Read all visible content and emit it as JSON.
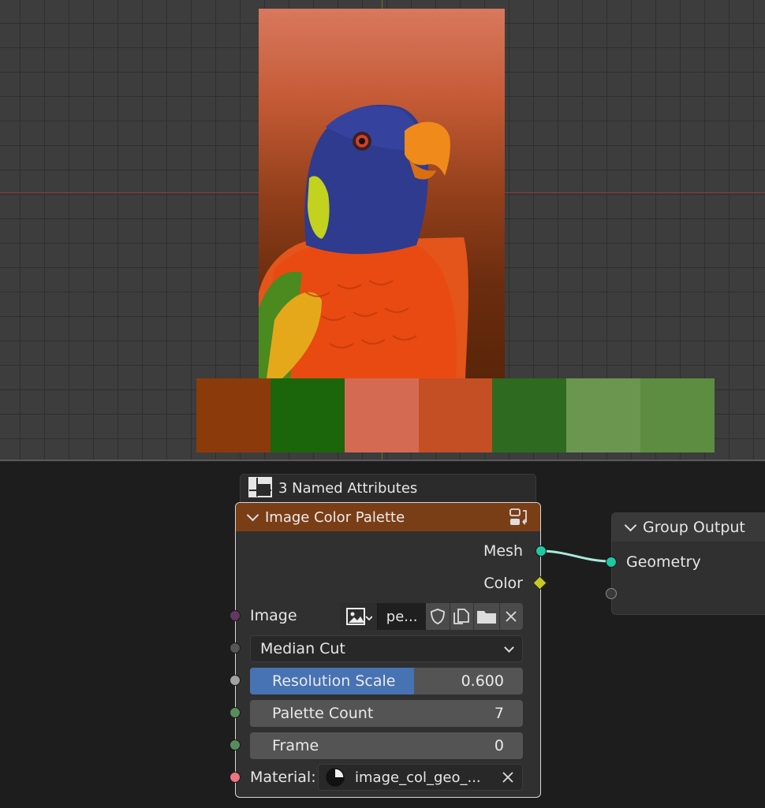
{
  "viewport": {
    "palette_colors": [
      "#8b3a0b",
      "#1b650b",
      "#d46a52",
      "#c44f24",
      "#2e6a20",
      "#6a9650",
      "#5c8d40"
    ]
  },
  "attributes_header": {
    "label": "3 Named Attributes",
    "icon": "spreadsheet-icon"
  },
  "node": {
    "title": "Image Color Palette",
    "outputs": {
      "mesh": "Mesh",
      "color": "Color"
    },
    "image": {
      "label": "Image",
      "value": "pe...",
      "icons": [
        "image-browse-icon",
        "fake-user-shield-icon",
        "duplicate-icon",
        "open-folder-icon",
        "close-icon"
      ]
    },
    "method": {
      "value": "Median Cut"
    },
    "resolution_scale": {
      "label": "Resolution Scale",
      "value": "0.600",
      "fill_fraction": 0.6
    },
    "palette_count": {
      "label": "Palette Count",
      "value": "7"
    },
    "frame": {
      "label": "Frame",
      "value": "0"
    },
    "material": {
      "label": "Material:",
      "value": "image_col_geo_..."
    }
  },
  "group_output": {
    "title": "Group Output",
    "input": "Geometry"
  },
  "colors": {
    "mesh_socket": "#1fc9a2",
    "color_socket": "#c7c729",
    "image_socket": "#633863",
    "menu_socket": "#555555",
    "float_socket": "#a1a1a1",
    "int_socket": "#598c5c",
    "material_socket": "#eb7582",
    "accent_blue": "#4772b3",
    "node_header": "#7a3e17"
  }
}
